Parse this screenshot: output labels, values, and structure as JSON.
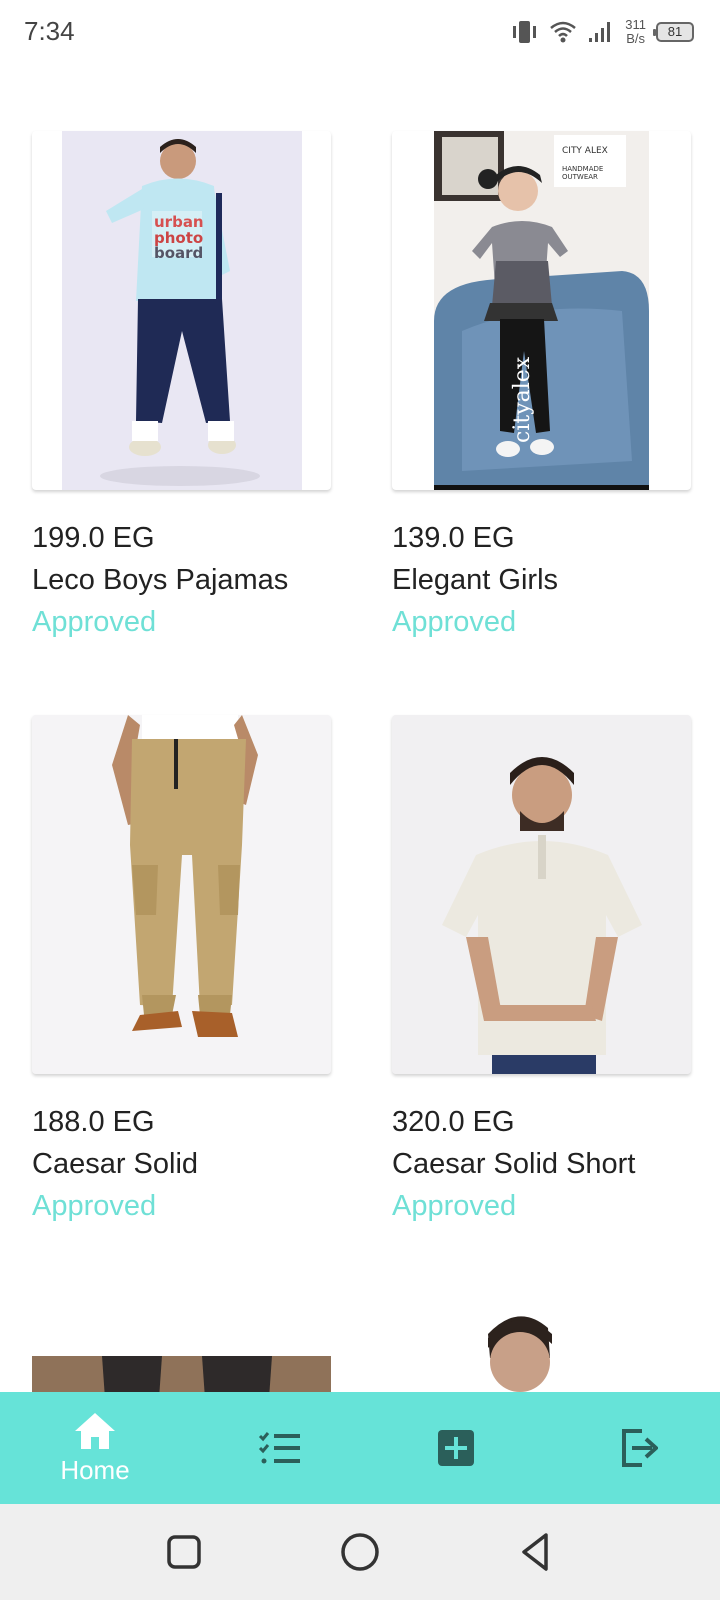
{
  "status_bar": {
    "time": "7:34",
    "net_speed_top": "311",
    "net_speed_bottom": "B/s",
    "battery": "81",
    "icons": [
      "vibrate-icon",
      "wifi-icon",
      "signal-icon",
      "battery-icon"
    ]
  },
  "products": [
    {
      "price": "199.0 EG",
      "title": "Leco Boys Pajamas",
      "status": "Approved",
      "image": "boy-in-hoodie-and-joggers"
    },
    {
      "price": "139.0 EG",
      "title": "Elegant Girls",
      "status": "Approved",
      "image": "girl-in-checkered-top",
      "watermark": "cityalex",
      "logo": "CITY ALEX"
    },
    {
      "price": "188.0 EG",
      "title": "Caesar Solid",
      "status": "Approved",
      "image": "khaki-cargo-pants"
    },
    {
      "price": "320.0 EG",
      "title": "Caesar Solid Short",
      "status": "Approved",
      "image": "man-in-henley-tshirt"
    },
    {
      "price": "",
      "title": "",
      "status": "",
      "image": "dark-pants-partial"
    },
    {
      "price": "",
      "title": "",
      "status": "",
      "image": "man-portrait-partial"
    }
  ],
  "bottom_nav": {
    "items": [
      {
        "label": "Home",
        "icon": "home-icon",
        "active": true
      },
      {
        "label": "",
        "icon": "list-icon"
      },
      {
        "label": "",
        "icon": "add-box-icon"
      },
      {
        "label": "",
        "icon": "logout-icon"
      }
    ]
  },
  "colors": {
    "accent": "#66e3d8",
    "status_text": "#6fe0d6",
    "icon_dark": "#2b5f5a"
  }
}
